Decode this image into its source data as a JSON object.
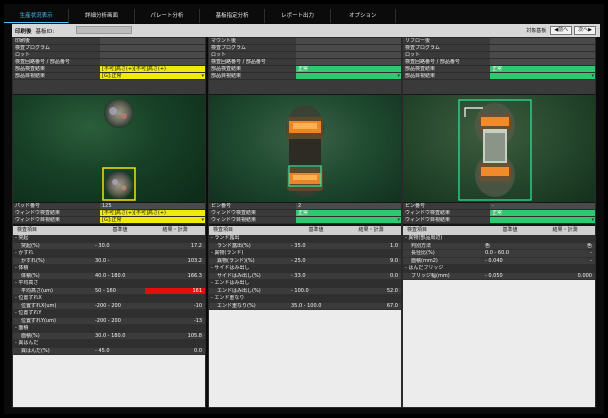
{
  "tabs": [
    {
      "label": "生産状況表示",
      "active": true
    },
    {
      "label": "詳細分析画面",
      "active": false
    },
    {
      "label": "パレート分析",
      "active": false
    },
    {
      "label": "基板指定分析",
      "active": false
    },
    {
      "label": "レポート出力",
      "active": false
    },
    {
      "label": "オプション",
      "active": false
    }
  ],
  "toolbar": {
    "process": "印刷後",
    "board_id_label": "基板ID:",
    "target_board_label": "対象基板",
    "prev_label": "◀前へ",
    "next_label": "次へ▶"
  },
  "panes": [
    {
      "info": [
        {
          "label": "印刷後",
          "value": "",
          "style": "blur"
        },
        {
          "label": "検査プログラム",
          "value": "",
          "style": "blur"
        },
        {
          "label": "ロット",
          "value": "",
          "style": "blur"
        },
        {
          "label": "検査回路番号 / 部品番号",
          "value": "",
          "style": "blur"
        },
        {
          "label": "部品検査結果",
          "value": "[不可]高さ(+)[不可]高さ(+)",
          "style": "yellow"
        },
        {
          "label": "部品目視結果",
          "value": "[G]:正常",
          "style": "yellow dd"
        }
      ],
      "window": [
        {
          "label": "パッド番号",
          "value": "125",
          "style": ""
        },
        {
          "label": "ウィンドウ検査結果",
          "value": "[不可]高さ(+)[不可]高さ(+)",
          "style": "yellow"
        },
        {
          "label": "ウィンドウ目視結果",
          "value": "[G]:正常",
          "style": "yellow dd"
        }
      ],
      "headers": {
        "item": "検査項目",
        "ref": "基準値",
        "result": "結果・計測"
      },
      "rows": [
        {
          "name": "- 突起",
          "ref": "",
          "val": "",
          "group": true
        },
        {
          "name": "突起(%)",
          "ref": "- 30.0",
          "val": "17.2"
        },
        {
          "name": "- かすれ",
          "ref": "",
          "val": "",
          "group": true
        },
        {
          "name": "かすれ(%)",
          "ref": "30.0 -",
          "val": "103.2"
        },
        {
          "name": "- 体積",
          "ref": "",
          "val": "",
          "group": true
        },
        {
          "name": "体積(%)",
          "ref": "40.0 - 180.0",
          "val": "166.3"
        },
        {
          "name": "- 平均高さ",
          "ref": "",
          "val": "",
          "group": true
        },
        {
          "name": "平均高さ(um)",
          "ref": "50 - 160",
          "val": "161",
          "red": true
        },
        {
          "name": "- 位置ずれX",
          "ref": "",
          "val": "",
          "group": true
        },
        {
          "name": "位置ずれX(um)",
          "ref": "-200 - 200",
          "val": "-10"
        },
        {
          "name": "- 位置ずれY",
          "ref": "",
          "val": "",
          "group": true
        },
        {
          "name": "位置ずれY(um)",
          "ref": "-200 - 200",
          "val": "-13"
        },
        {
          "name": "- 面積",
          "ref": "",
          "val": "",
          "group": true
        },
        {
          "name": "面積(%)",
          "ref": "30.0 - 180.0",
          "val": "105.8"
        },
        {
          "name": "- 異はんだ",
          "ref": "",
          "val": "",
          "group": true
        },
        {
          "name": "異はんだ(%)",
          "ref": "- 45.0",
          "val": "0.0"
        }
      ]
    },
    {
      "info": [
        {
          "label": "マウント後",
          "value": "",
          "style": "blur"
        },
        {
          "label": "検査プログラム",
          "value": "",
          "style": "blur"
        },
        {
          "label": "ロット",
          "value": "",
          "style": "blur"
        },
        {
          "label": "検査回路番号 / 部品番号",
          "value": "",
          "style": "blur"
        },
        {
          "label": "部品検査結果",
          "value": "正常",
          "style": "green"
        },
        {
          "label": "部品目視結果",
          "value": "",
          "style": "green dd"
        }
      ],
      "window": [
        {
          "label": "ピン番号",
          "value": "2",
          "style": ""
        },
        {
          "label": "ウィンドウ検査結果",
          "value": "正常",
          "style": "green"
        },
        {
          "label": "ウィンドウ目視結果",
          "value": "",
          "style": "green dd"
        }
      ],
      "headers": {
        "item": "検査項目",
        "ref": "基準値",
        "result": "結果・計測"
      },
      "rows": [
        {
          "name": "- ランド露出",
          "ref": "",
          "val": "",
          "group": true
        },
        {
          "name": "ランド露出(%)",
          "ref": "- 35.0",
          "val": "1.0"
        },
        {
          "name": "- 異物(ランド)",
          "ref": "",
          "val": "",
          "group": true
        },
        {
          "name": "異物(ランド)(%)",
          "ref": "- 25.0",
          "val": "9.0"
        },
        {
          "name": "- サイドはみ出し",
          "ref": "",
          "val": "",
          "group": true
        },
        {
          "name": "サイドはみ出し(%)",
          "ref": "- 33.0",
          "val": "0.0"
        },
        {
          "name": "- エンドはみ出し",
          "ref": "",
          "val": "",
          "group": true
        },
        {
          "name": "エンドはみ出し(%)",
          "ref": "- 100.0",
          "val": "52.0"
        },
        {
          "name": "- エンド重なり",
          "ref": "",
          "val": "",
          "group": true
        },
        {
          "name": "エンド重なり(%)",
          "ref": "35.0 - 100.0",
          "val": "67.0"
        }
      ]
    },
    {
      "info": [
        {
          "label": "リフロー後",
          "value": "",
          "style": "blur"
        },
        {
          "label": "検査プログラム",
          "value": "",
          "style": "blur"
        },
        {
          "label": "ロット",
          "value": "",
          "style": "blur"
        },
        {
          "label": "検査回路番号 / 部品番号",
          "value": "",
          "style": "blur"
        },
        {
          "label": "部品検査結果",
          "value": "正常",
          "style": "green"
        },
        {
          "label": "部品目視結果",
          "value": "",
          "style": "green dd"
        }
      ],
      "window": [
        {
          "label": "ピン番号",
          "value": "-",
          "style": ""
        },
        {
          "label": "ウィンドウ検査結果",
          "value": "正常",
          "style": "green"
        },
        {
          "label": "ウィンドウ目視結果",
          "value": "",
          "style": "green dd"
        }
      ],
      "headers": {
        "item": "検査項目",
        "ref": "基準値",
        "result": "結果・計測"
      },
      "rows": [
        {
          "name": "- 異物(部品周辺)",
          "ref": "",
          "val": "",
          "group": true
        },
        {
          "name": "判別方法",
          "ref": "色",
          "val": "色"
        },
        {
          "name": "長径比(%)",
          "ref": "0.0 - 60.0",
          "val": "-"
        },
        {
          "name": "面積(mm2)",
          "ref": "- 0.040",
          "val": "-"
        },
        {
          "name": "- はんだブリッジ",
          "ref": "",
          "val": "",
          "group": true
        },
        {
          "name": "ブリッジ幅(mm)",
          "ref": "- 0.050",
          "val": "0.000"
        }
      ]
    }
  ]
}
